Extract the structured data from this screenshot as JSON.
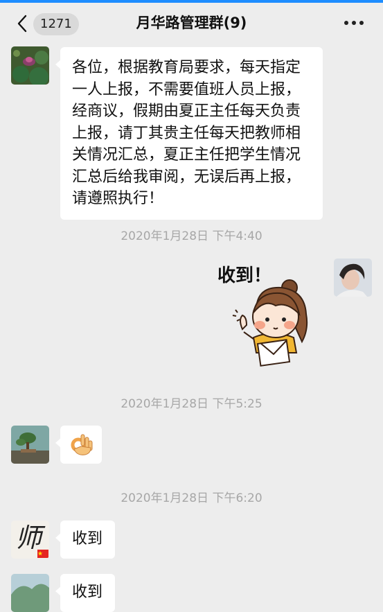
{
  "header": {
    "unread_count": "1271",
    "title": "月华路管理群(9)"
  },
  "messages": [
    {
      "type": "text",
      "text": "各位，根据教育局要求，每天指定一人上报，不需要值班人员上报，经商议，假期由夏正主任每天负责上报，请丁其贵主任每天把教师相关情况汇总，夏正主任把学生情况汇总后给我审阅，无误后再上报，请遵照执行！"
    },
    {
      "type": "timestamp",
      "text": "2020年1月28日 下午4:40"
    },
    {
      "type": "sticker",
      "text": "收到！",
      "icon": "girl-holding-letter-sticker"
    },
    {
      "type": "timestamp",
      "text": "2020年1月28日 下午5:25"
    },
    {
      "type": "emoji",
      "icon": "ok-hand-icon"
    },
    {
      "type": "timestamp",
      "text": "2020年1月28日 下午6:20"
    },
    {
      "type": "text",
      "text": "收到"
    },
    {
      "type": "text",
      "text": "收到"
    }
  ],
  "avatar_badge_text": "师"
}
